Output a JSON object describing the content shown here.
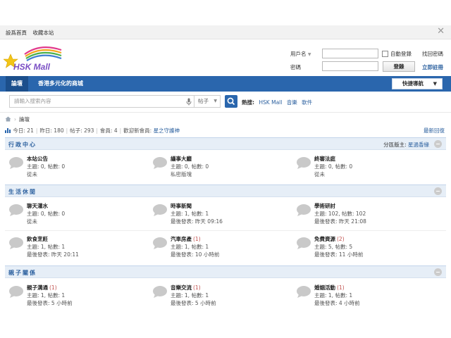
{
  "topbar": {
    "set_home": "設爲首頁",
    "bookmark": "收藏本站"
  },
  "login": {
    "username_label": "用戶名",
    "password_label": "密碼",
    "auto_login": "自動登錄",
    "forgot": "找回密碼",
    "login_button": "登錄",
    "register": "立即註冊"
  },
  "logo": {
    "text": "HSK Mall"
  },
  "nav": {
    "forum": "論壇",
    "mall": "香港多元化的商城",
    "quick_nav": "快捷導航"
  },
  "search": {
    "placeholder": "請輸入搜索內容",
    "scope": "帖子",
    "hot_label": "熱搜:",
    "hot_items": [
      "HSK Mall",
      "音樂",
      "軟件"
    ]
  },
  "breadcrumb": {
    "current": "論壇"
  },
  "stats": {
    "today": "今日: 21",
    "yesterday": "昨日: 180",
    "posts": "帖子: 293",
    "members": "會員: 4",
    "welcome_label": "歡迎新會員:",
    "new_member": "星之守護神",
    "latest": "最新回復"
  },
  "sections": [
    {
      "title": "行政中心",
      "moderator_label": "分區版主:",
      "moderator": "星過香緣",
      "forums": [
        {
          "name": "本站公告",
          "new": "",
          "meta": "主題: 0, 帖數: 0",
          "last": "從未"
        },
        {
          "name": "議事大廳",
          "new": "",
          "meta": "主題: 0, 帖數: 0",
          "last": "私密版塊"
        },
        {
          "name": "終審法庭",
          "new": "",
          "meta": "主題: 0, 帖數: 0",
          "last": "從未"
        }
      ]
    },
    {
      "title": "生活休閒",
      "moderator_label": "",
      "moderator": "",
      "forums": [
        {
          "name": "聊天灌水",
          "new": "",
          "meta": "主題: 0, 帖數: 0",
          "last": "從未"
        },
        {
          "name": "時事新聞",
          "new": "",
          "meta": "主題: 1, 帖數: 1",
          "last": "最後發表: 昨天 09:16"
        },
        {
          "name": "學術研討",
          "new": "",
          "meta": "主題: 102, 帖數: 102",
          "last": "最後發表: 昨天 21:08"
        },
        {
          "name": "飲食烹飪",
          "new": "",
          "meta": "主題: 1, 帖數: 1",
          "last": "最後發表: 昨天 20:11"
        },
        {
          "name": "汽車房產",
          "new": "(1)",
          "meta": "主題: 1, 帖數: 1",
          "last": "最後發表: 10 小時前"
        },
        {
          "name": "免費資源",
          "new": "(2)",
          "meta": "主題: 5, 帖數: 5",
          "last": "最後發表: 11 小時前"
        }
      ]
    },
    {
      "title": "親子關係",
      "moderator_label": "",
      "moderator": "",
      "forums": [
        {
          "name": "親子溝通",
          "new": "(1)",
          "meta": "主題: 1, 帖數: 1",
          "last": "最後發表: 5 小時前"
        },
        {
          "name": "音樂交流",
          "new": "(1)",
          "meta": "主題: 1, 帖數: 1",
          "last": "最後發表: 5 小時前"
        },
        {
          "name": "婚姻活動",
          "new": "(1)",
          "meta": "主題: 1, 帖數: 1",
          "last": "最後發表: 4 小時前"
        }
      ]
    }
  ],
  "colors": {
    "nav_blue": "#2a66ad",
    "link_blue": "#2a5f9e",
    "new_red": "#c0504d",
    "section_bg": "#e6eef7"
  }
}
